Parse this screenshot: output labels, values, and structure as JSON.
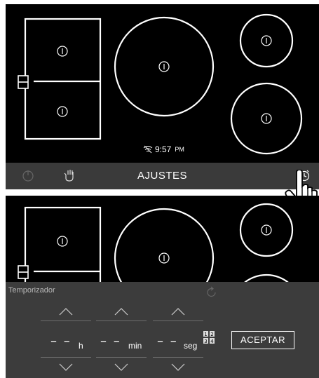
{
  "screen1": {
    "clock": {
      "time": "9:57",
      "ampm": "PM",
      "wifi_icon": "wifi-off-icon"
    },
    "bar": {
      "title": "AJUSTES",
      "icons": [
        "power-icon",
        "hand-lock-icon",
        "timer-icon"
      ]
    }
  },
  "screen2": {
    "timer": {
      "label": "Temporizador",
      "hours": {
        "value": "– –",
        "unit": "h"
      },
      "minutes": {
        "value": "– –",
        "unit": "min"
      },
      "seconds": {
        "value": "– –",
        "unit": "seg"
      },
      "accept_label": "ACEPTAR"
    }
  },
  "colors": {
    "background": "#000000",
    "bar": "#3a3a3a",
    "panel": "#3c3c3c",
    "zone_outline": "#ffffff"
  }
}
